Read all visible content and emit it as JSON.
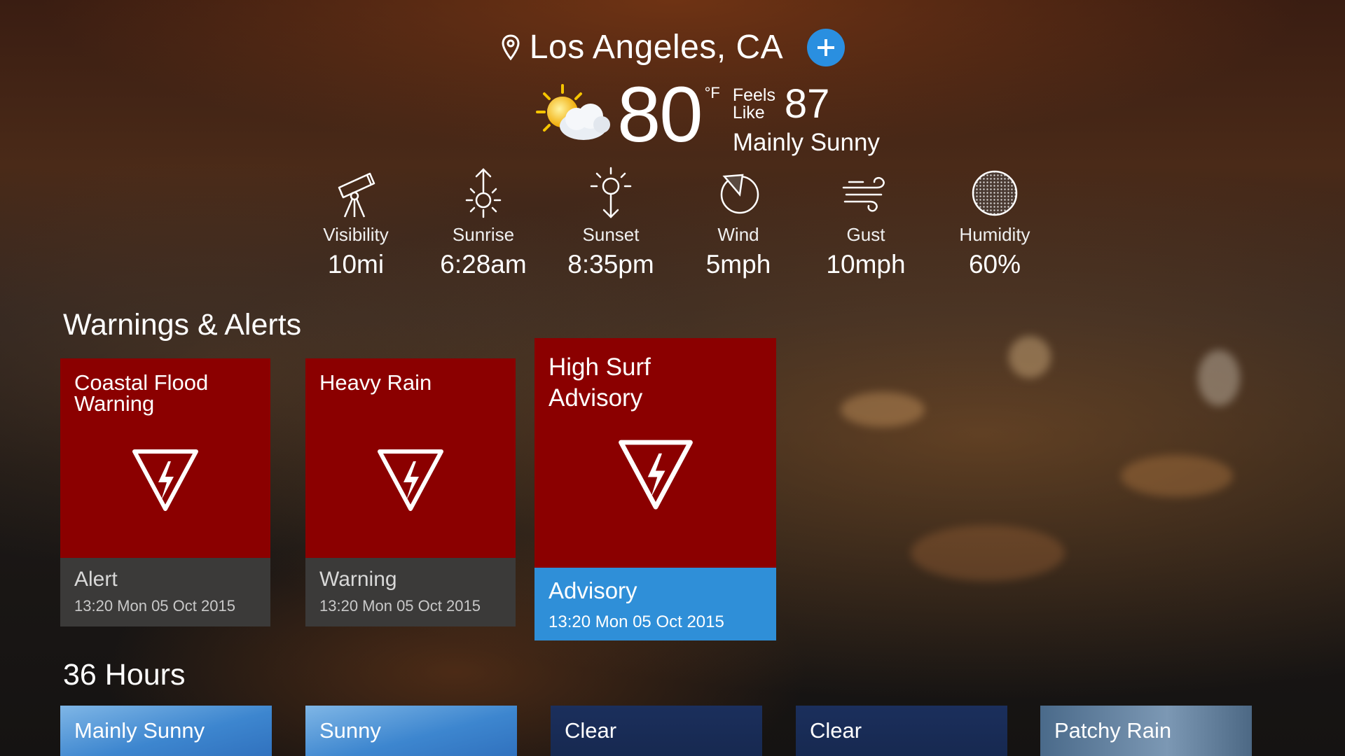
{
  "location": {
    "name": "Los Angeles, CA",
    "add_icon": "plus-icon",
    "pin_icon": "location-pin-icon"
  },
  "current": {
    "temperature": "80",
    "unit": "°F",
    "feels_like_label": "Feels Like",
    "feels_like_value": "87",
    "condition": "Mainly Sunny",
    "icon": "sun-behind-cloud-icon"
  },
  "stats": [
    {
      "label": "Visibility",
      "value": "10mi",
      "icon": "telescope-icon"
    },
    {
      "label": "Sunrise",
      "value": "6:28am",
      "icon": "sunrise-icon"
    },
    {
      "label": "Sunset",
      "value": "8:35pm",
      "icon": "sunset-icon"
    },
    {
      "label": "Wind",
      "value": "5mph",
      "icon": "wind-direction-icon"
    },
    {
      "label": "Gust",
      "value": "10mph",
      "icon": "gust-icon"
    },
    {
      "label": "Humidity",
      "value": "60%",
      "icon": "humidity-icon"
    }
  ],
  "warnings": {
    "title": "Warnings & Alerts",
    "cards": [
      {
        "title": "Coastal Flood Warning",
        "type": "Alert",
        "time": "13:20 Mon 05 Oct 2015",
        "icon": "warning-lightning-icon"
      },
      {
        "title": "Heavy Rain",
        "type": "Warning",
        "time": "13:20 Mon 05 Oct 2015",
        "icon": "warning-lightning-icon"
      },
      {
        "title": "High Surf Advisory",
        "type": "Advisory",
        "time": "13:20 Mon 05 Oct 2015",
        "icon": "warning-lightning-icon"
      }
    ]
  },
  "forecast": {
    "title": "36 Hours",
    "items": [
      {
        "label": "Mainly Sunny"
      },
      {
        "label": "Sunny"
      },
      {
        "label": "Clear"
      },
      {
        "label": "Clear"
      },
      {
        "label": "Patchy Rain"
      }
    ]
  },
  "colors": {
    "accent_blue": "#2a8fe0",
    "alert_red": "#8b0000",
    "advisory_blue": "#2f8fd8",
    "card_footer_gray": "#3b3a39"
  }
}
